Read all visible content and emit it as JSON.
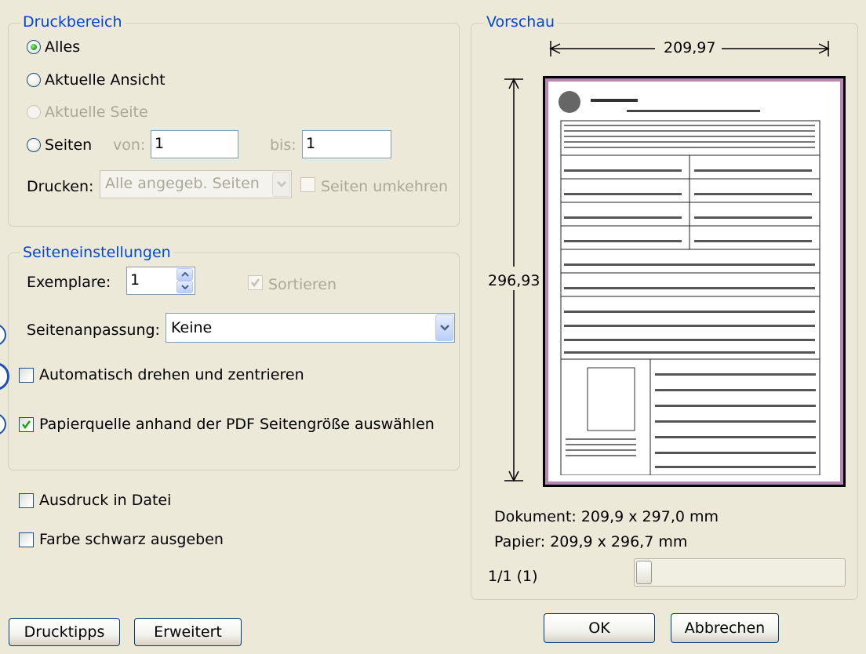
{
  "print_range": {
    "legend": "Druckbereich",
    "option_all": "Alles",
    "option_current_view": "Aktuelle Ansicht",
    "option_current_page": "Aktuelle Seite",
    "option_pages": "Seiten",
    "from_label": "von:",
    "from_value": "1",
    "to_label": "bis:",
    "to_value": "1",
    "print_label": "Drucken:",
    "print_select_value": "Alle angegeb. Seiten",
    "reverse_pages_label": "Seiten umkehren"
  },
  "page_settings": {
    "legend": "Seiteneinstellungen",
    "copies_label": "Exemplare:",
    "copies_value": "1",
    "collate_label": "Sortieren",
    "page_scaling_label": "Seitenanpassung:",
    "page_scaling_value": "Keine",
    "auto_rotate_label": "Automatisch drehen und zentrieren",
    "paper_source_label": "Papierquelle anhand der PDF Seitengröße auswählen"
  },
  "options": {
    "print_to_file_label": "Ausdruck in Datei",
    "print_black_label": "Farbe schwarz ausgeben"
  },
  "preview": {
    "legend": "Vorschau",
    "width_dim": "209,97",
    "height_dim": "296,93",
    "document_info": "Dokument: 209,9 x 297,0 mm",
    "paper_info": "Papier: 209,9 x 296,7 mm",
    "page_indicator": "1/1 (1)",
    "page_slider_fraction": 0
  },
  "buttons": {
    "print_tips": "Drucktipps",
    "advanced": "Erweitert",
    "ok": "OK",
    "cancel": "Abbrechen"
  },
  "colors": {
    "legend_text": "#0046d5",
    "dialog_bg": "#ece9d8",
    "radio_dot": "#21a121",
    "check_mark": "#21a121"
  },
  "icons": [
    "radio-selected",
    "radio",
    "checkbox-checked",
    "checkbox",
    "chevron-down-icon",
    "spin-up-icon",
    "spin-down-icon",
    "arrow-icon"
  ]
}
